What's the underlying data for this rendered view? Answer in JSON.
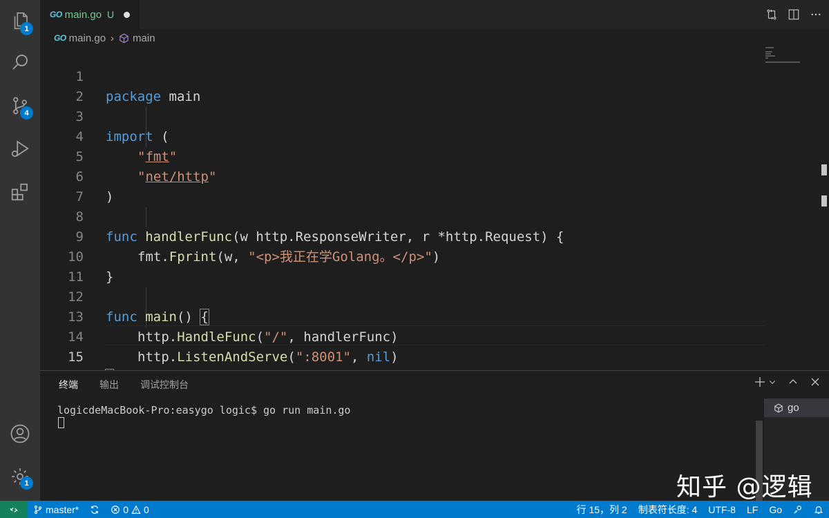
{
  "activity_bar": {
    "explorer_badge": "1",
    "scm_badge": "4",
    "manage_badge": "1"
  },
  "tab": {
    "go_mark": "GO",
    "title": "main.go",
    "status": "U"
  },
  "breadcrumb": {
    "file": "main.go",
    "symbol": "main"
  },
  "editor": {
    "active_line": 15,
    "lines": [
      {
        "n": "1"
      },
      {
        "n": "2"
      },
      {
        "n": "3"
      },
      {
        "n": "4"
      },
      {
        "n": "5"
      },
      {
        "n": "6"
      },
      {
        "n": "7"
      },
      {
        "n": "8"
      },
      {
        "n": "9"
      },
      {
        "n": "10"
      },
      {
        "n": "11"
      },
      {
        "n": "12"
      },
      {
        "n": "13"
      },
      {
        "n": "14"
      },
      {
        "n": "15"
      }
    ],
    "tokens": {
      "l1_kw": "package",
      "l1_rest": " main",
      "l3_kw": "import",
      "l3_rest": " (",
      "l4_q1": "\"",
      "l4_str": "fmt",
      "l4_q2": "\"",
      "l5_q1": "\"",
      "l5_str": "net/http",
      "l5_q2": "\"",
      "l6": ")",
      "l8_kw": "func",
      "l8_fn": "handlerFunc",
      "l8_rest": "(w http.ResponseWriter, r *http.Request) {",
      "l9_pre": "fmt.",
      "l9_fn": "Fprint",
      "l9_mid": "(w, ",
      "l9_str": "\"<p>我正在学Golang。</p>\"",
      "l9_end": ")",
      "l10": "}",
      "l12_kw": "func",
      "l12_fn": "main",
      "l12_rest": "() ",
      "l12_brace": "{",
      "l13_pre": "http.",
      "l13_fn": "HandleFunc",
      "l13_mid": "(",
      "l13_str": "\"/\"",
      "l13_end": ", handlerFunc)",
      "l14_pre": "http.",
      "l14_fn": "ListenAndServe",
      "l14_mid": "(",
      "l14_str": "\":8001\"",
      "l14_sep": ", ",
      "l14_kw": "nil",
      "l14_end": ")",
      "l15": "}"
    }
  },
  "panel": {
    "tabs": [
      "终端",
      "输出",
      "调试控制台"
    ],
    "active_tab": "终端",
    "terminal_line": "logicdeMacBook-Pro:easygo logic$ go run main.go",
    "terminal_instance": "go"
  },
  "watermark": "知乎 @逻辑",
  "status_bar": {
    "branch": "master*",
    "errors": "0",
    "warnings": "0",
    "position": "行 15，列 2",
    "indent": "制表符长度: 4",
    "encoding": "UTF-8",
    "eol": "LF",
    "language": "Go"
  },
  "colors": {
    "status_bar": "#007acc",
    "remote": "#16825d",
    "keyword": "#569cd6",
    "string": "#ce9178",
    "function": "#dcdcaa",
    "modified_tab": "#73c991"
  }
}
